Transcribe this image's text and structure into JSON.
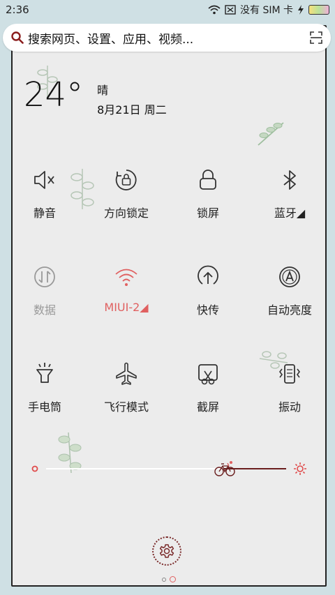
{
  "status": {
    "time": "2:36",
    "no_sim_text": "没有 SIM 卡"
  },
  "search": {
    "placeholder": "搜索网页、设置、应用、视频..."
  },
  "weather": {
    "temperature": "24°",
    "condition": "晴",
    "date": "8月21日 周二"
  },
  "toggles": [
    {
      "label": "静音",
      "icon": "mute-icon"
    },
    {
      "label": "方向锁定",
      "icon": "rotation-lock-icon"
    },
    {
      "label": "锁屏",
      "icon": "lock-icon"
    },
    {
      "label": "蓝牙◢",
      "icon": "bluetooth-icon"
    },
    {
      "label": "数据",
      "icon": "data-icon"
    },
    {
      "label": "MIUI-2◢",
      "icon": "wifi-icon"
    },
    {
      "label": "快传",
      "icon": "quick-transfer-icon"
    },
    {
      "label": "自动亮度",
      "icon": "auto-brightness-icon"
    },
    {
      "label": "手电筒",
      "icon": "flashlight-icon"
    },
    {
      "label": "飞行模式",
      "icon": "airplane-icon"
    },
    {
      "label": "截屏",
      "icon": "screenshot-icon"
    },
    {
      "label": "振动",
      "icon": "vibrate-icon"
    }
  ],
  "brightness": {
    "level": 0.74
  },
  "colors": {
    "accent_red": "#e06060",
    "dark_red": "#7a2a2a",
    "panel_bg": "#ececec",
    "outer_bg": "#cfe0e4"
  }
}
